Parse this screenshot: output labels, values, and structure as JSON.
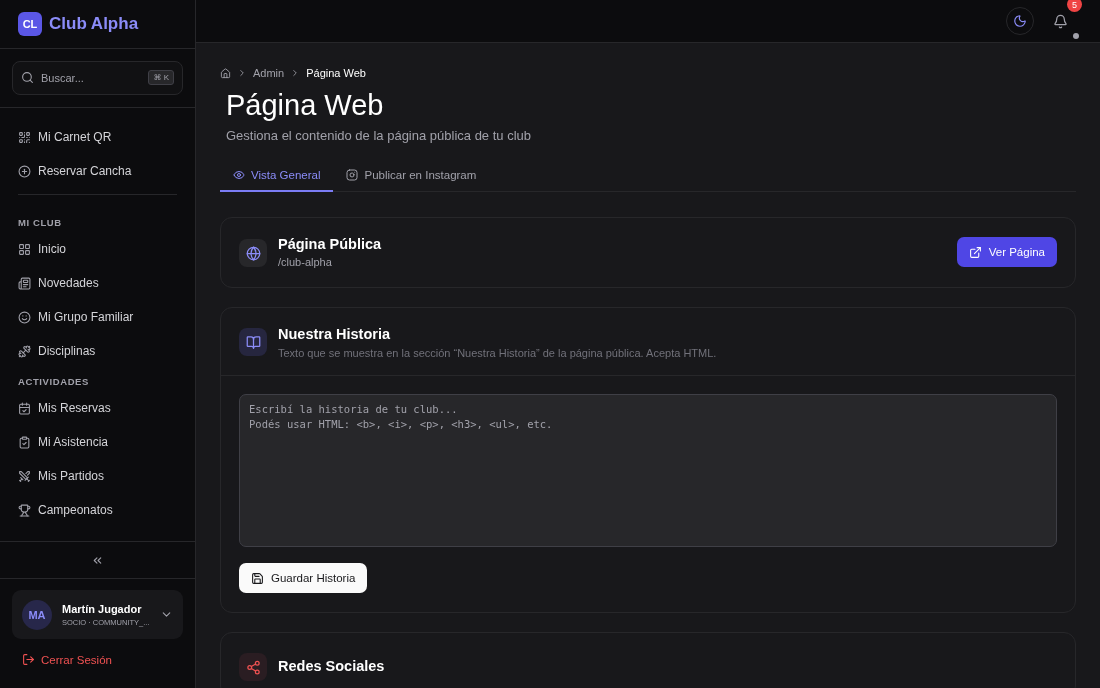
{
  "sidebar": {
    "logo": {
      "initials": "CL",
      "name": "Club Alpha"
    },
    "search": {
      "placeholder": "Buscar...",
      "shortcut": "⌘ K"
    },
    "quick_items": [
      {
        "label": "Mi Carnet QR",
        "selected": false
      },
      {
        "label": "Reservar Cancha",
        "selected": false
      }
    ],
    "sections": [
      {
        "title": "MI CLUB",
        "items": [
          {
            "label": "Inicio",
            "selected": false
          },
          {
            "label": "Novedades",
            "selected": false
          },
          {
            "label": "Mi Grupo Familiar",
            "selected": false
          },
          {
            "label": "Disciplinas",
            "selected": false
          }
        ]
      },
      {
        "title": "ACTIVIDADES",
        "items": [
          {
            "label": "Mis Reservas",
            "selected": false
          },
          {
            "label": "Mi Asistencia",
            "selected": false
          },
          {
            "label": "Mis Partidos",
            "selected": false
          },
          {
            "label": "Campeonatos",
            "selected": false
          }
        ]
      }
    ],
    "user": {
      "initials": "MA",
      "name": "Martín Jugador",
      "role": "SOCIO · COMMUNITY_..."
    },
    "logout": "Cerrar Sesión"
  },
  "topbar": {
    "notifications": "5"
  },
  "breadcrumb": [
    "Admin",
    "Página Web"
  ],
  "page": {
    "title": "Página Web",
    "subtitle": "Gestiona el contenido de la página pública de tu club"
  },
  "tabs": [
    {
      "label": "Vista General",
      "selected": true
    },
    {
      "label": "Publicar en Instagram",
      "selected": false
    }
  ],
  "public_page": {
    "title": "Página Pública",
    "path": "/club-alpha",
    "button": "Ver Página"
  },
  "history": {
    "title": "Nuestra Historia",
    "description": "Texto que se muestra en la sección “Nuestra Historia” de la página pública. Acepta HTML.",
    "placeholder": "Escribí la historia de tu club...\nPodés usar HTML: <b>, <i>, <p>, <h3>, <ul>, etc.",
    "button": "Guardar Historia"
  },
  "social": {
    "title": "Redes Sociales"
  }
}
